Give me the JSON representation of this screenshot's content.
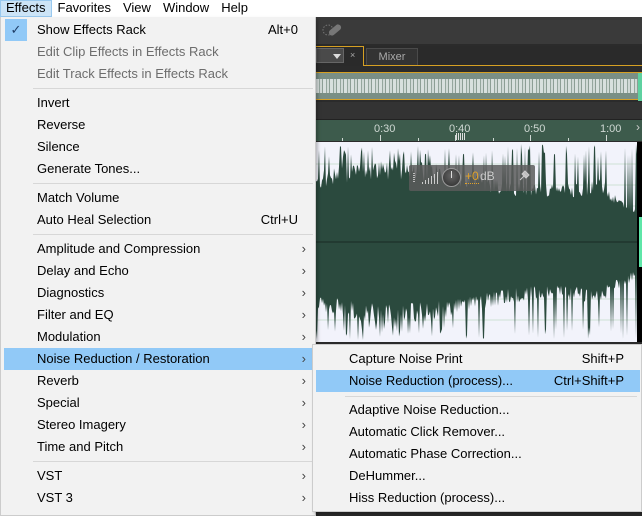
{
  "menubar": {
    "items": [
      {
        "label": "Effects",
        "active": true
      },
      {
        "label": "Favorites"
      },
      {
        "label": "View"
      },
      {
        "label": "Window"
      },
      {
        "label": "Help"
      }
    ]
  },
  "effects_menu": {
    "items": [
      {
        "label": "Show Effects Rack",
        "shortcut": "Alt+0",
        "checked": true
      },
      {
        "label": "Edit Clip Effects in Effects Rack",
        "disabled": true
      },
      {
        "label": "Edit Track Effects in Effects Rack",
        "disabled": true
      },
      {
        "label": "Invert"
      },
      {
        "label": "Reverse"
      },
      {
        "label": "Silence"
      },
      {
        "label": "Generate Tones..."
      },
      {
        "label": "Match Volume"
      },
      {
        "label": "Auto Heal Selection",
        "shortcut": "Ctrl+U"
      },
      {
        "label": "Amplitude and Compression",
        "submenu": true
      },
      {
        "label": "Delay and Echo",
        "submenu": true
      },
      {
        "label": "Diagnostics",
        "submenu": true
      },
      {
        "label": "Filter and EQ",
        "submenu": true
      },
      {
        "label": "Modulation",
        "submenu": true
      },
      {
        "label": "Noise Reduction / Restoration",
        "submenu": true,
        "highlighted": true
      },
      {
        "label": "Reverb",
        "submenu": true
      },
      {
        "label": "Special",
        "submenu": true
      },
      {
        "label": "Stereo Imagery",
        "submenu": true
      },
      {
        "label": "Time and Pitch",
        "submenu": true
      },
      {
        "label": "VST",
        "submenu": true
      },
      {
        "label": "VST 3",
        "submenu": true
      }
    ],
    "check_glyph": "✓",
    "arrow_glyph": "›"
  },
  "noise_submenu": {
    "items": [
      {
        "label": "Capture Noise Print",
        "shortcut": "Shift+P"
      },
      {
        "label": "Noise Reduction (process)...",
        "shortcut": "Ctrl+Shift+P",
        "highlighted": true
      },
      {
        "label": "Adaptive Noise Reduction..."
      },
      {
        "label": "Automatic Click Remover..."
      },
      {
        "label": "Automatic Phase Correction..."
      },
      {
        "label": "DeHummer..."
      },
      {
        "label": "Hiss Reduction (process)..."
      }
    ]
  },
  "editor": {
    "tabs": {
      "close_glyph": "×",
      "mixer_label": "Mixer"
    },
    "ruler": {
      "labels": [
        "0:30",
        "0:40",
        "0:50",
        "1:00"
      ],
      "arrow_glyph": "›"
    },
    "hud": {
      "value": "+0",
      "unit": "dB",
      "pin_glyph": "✈"
    },
    "colors": {
      "accent": "#d6a023",
      "waveform": "#2b4a3e",
      "highlight": "#91c9f7"
    }
  }
}
